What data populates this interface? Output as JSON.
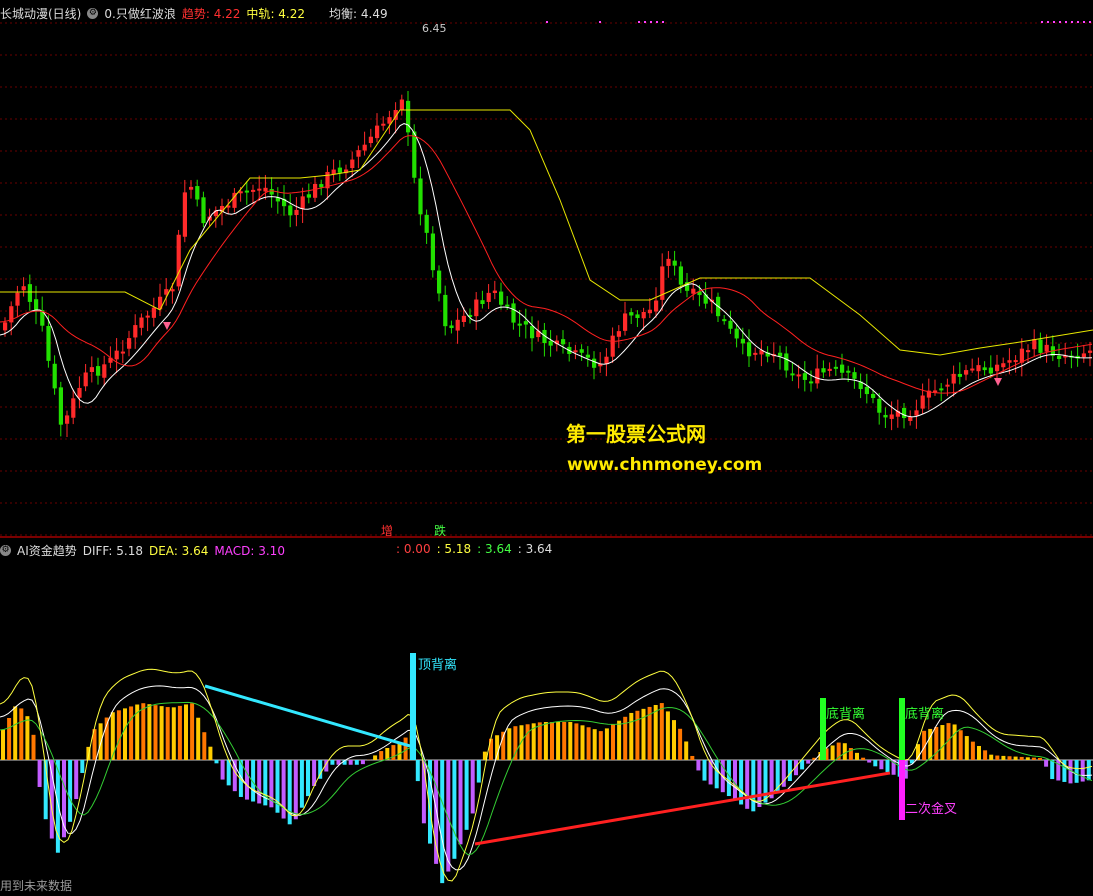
{
  "top_header": {
    "title": "长城动漫(日线)",
    "indicator": "0.只做红波浪",
    "trend_label": "趋势",
    "trend_value": "4.22",
    "mid_label": "中轨",
    "mid_value": "4.22",
    "balance_label": "均衡",
    "balance_value": "4.49"
  },
  "price_peak_label": "6.45",
  "watermark": {
    "line1": "第一股票公式网",
    "line2": "www.chnmoney.com"
  },
  "signals": {
    "up": "增",
    "down": "跌"
  },
  "bottom_header": {
    "title": "AI资金趋势",
    "diff_label": "DIFF",
    "diff_value": "5.18",
    "dea_label": "DEA",
    "dea_value": "3.64",
    "macd_label": "MACD",
    "macd_value": "3.10",
    "extra1": ": 0.00",
    "extra2": ": 5.18",
    "extra3": ": 3.64",
    "extra4": ": 3.64"
  },
  "annotations": {
    "top_divergence": "顶背离",
    "bottom_divergence_1": "底背离",
    "bottom_divergence_2": "底背离",
    "second_golden_cross": "二次金叉"
  },
  "footer_note": "用到未来数据",
  "colors": {
    "up": "#ff2a2a",
    "down": "#22e000",
    "yellow_line": "#e8e800",
    "red_line": "#ff2020",
    "white_line": "#ffffff",
    "cyan": "#33e8ff",
    "magenta": "#c25cff",
    "orange": "#ff7700"
  }
}
